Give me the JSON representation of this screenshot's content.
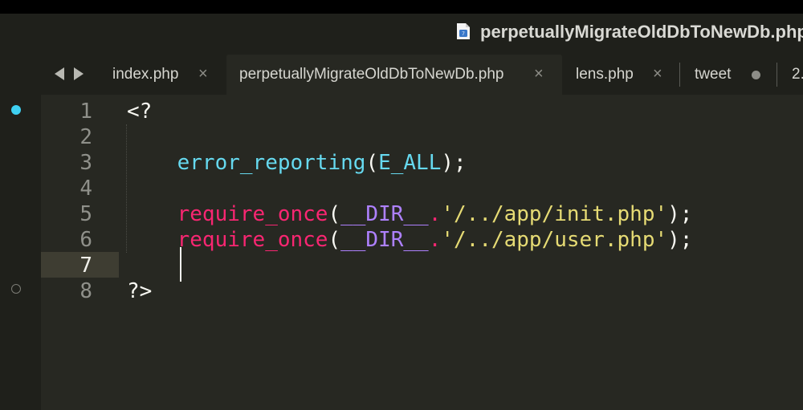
{
  "window": {
    "title": "perpetuallyMigrateOldDbToNewDb.php",
    "file_icon": "php-file-icon"
  },
  "tabs": [
    {
      "label": "index.php",
      "state": "close"
    },
    {
      "label": "perpetuallyMigrateOldDbToNewDb.php",
      "state": "close",
      "active": true
    },
    {
      "label": "lens.php",
      "state": "close"
    },
    {
      "label": "tweet",
      "state": "modified"
    },
    {
      "label": "2.",
      "state": "none"
    }
  ],
  "tab_close_glyph": "×",
  "editor": {
    "current_line": 7,
    "lines": [
      {
        "num": "1",
        "tokens": [
          {
            "t": "<?",
            "c": "punct"
          }
        ]
      },
      {
        "num": "2",
        "tokens": []
      },
      {
        "num": "3",
        "tokens": [
          {
            "t": "    ",
            "c": "punct"
          },
          {
            "t": "error_reporting",
            "c": "func"
          },
          {
            "t": "(",
            "c": "punct"
          },
          {
            "t": "E_ALL",
            "c": "const"
          },
          {
            "t": ");",
            "c": "punct"
          }
        ]
      },
      {
        "num": "4",
        "tokens": []
      },
      {
        "num": "5",
        "tokens": [
          {
            "t": "    ",
            "c": "punct"
          },
          {
            "t": "require_once",
            "c": "kw"
          },
          {
            "t": "(",
            "c": "punct"
          },
          {
            "t": "__DIR__",
            "c": "magic"
          },
          {
            "t": ".",
            "c": "kw"
          },
          {
            "t": "'/../app/init.php'",
            "c": "str"
          },
          {
            "t": ");",
            "c": "punct"
          }
        ]
      },
      {
        "num": "6",
        "tokens": [
          {
            "t": "    ",
            "c": "punct"
          },
          {
            "t": "require_once",
            "c": "kw"
          },
          {
            "t": "(",
            "c": "punct"
          },
          {
            "t": "__DIR__",
            "c": "magic"
          },
          {
            "t": ".",
            "c": "kw"
          },
          {
            "t": "'/../app/user.php'",
            "c": "str"
          },
          {
            "t": ");",
            "c": "punct"
          }
        ]
      },
      {
        "num": "7",
        "tokens": []
      },
      {
        "num": "8",
        "tokens": [
          {
            "t": "?>",
            "c": "punct"
          }
        ]
      }
    ]
  },
  "colors": {
    "background": "#272822",
    "chrome": "#1f201b",
    "function": "#66d9ef",
    "keyword": "#f92672",
    "magic_constant": "#ae81ff",
    "string": "#e6db74",
    "bookmark_dot": "#3fd0f2"
  }
}
